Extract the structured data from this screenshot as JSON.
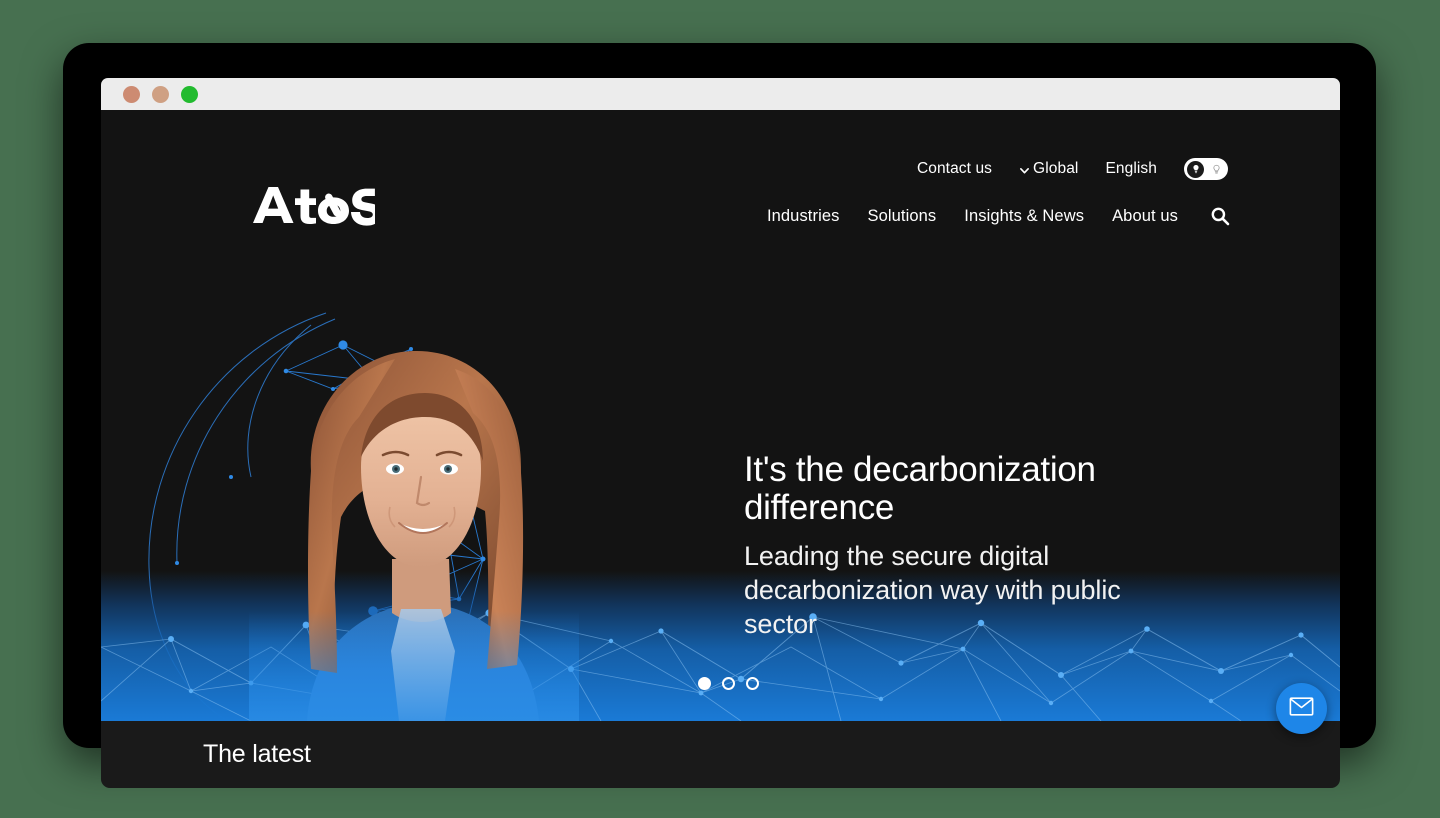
{
  "window": {
    "traffic_lights": [
      "close",
      "minimize",
      "maximize"
    ]
  },
  "brand": {
    "logo_text": "AtoS",
    "logo_alt": "Atos"
  },
  "utility_nav": {
    "items": [
      {
        "label": "Contact us",
        "icon": null,
        "name": "contact-us"
      },
      {
        "label": "Global",
        "icon": "chevron-down-icon",
        "name": "region-selector"
      },
      {
        "label": "English",
        "icon": null,
        "name": "language-selector"
      }
    ],
    "theme_toggle": {
      "name": "theme-toggle",
      "state": "dark",
      "on_icon": "lightbulb-filled-icon",
      "off_icon": "lightbulb-outline-icon"
    }
  },
  "main_nav": {
    "items": [
      {
        "label": "Industries",
        "name": "industries"
      },
      {
        "label": "Solutions",
        "name": "solutions"
      },
      {
        "label": "Insights & News",
        "name": "insights-and-news"
      },
      {
        "label": "About us",
        "name": "about-us"
      }
    ],
    "search": {
      "icon": "search-icon",
      "label": "Search"
    }
  },
  "hero": {
    "title": "It's the decarbonization difference",
    "subtitle": "Leading the secure digital decarbonization way with public sector",
    "image_alt": "Smiling woman with long auburn hair in front of a blue digital network globe",
    "carousel": {
      "total_slides": 3,
      "active_slide": 1,
      "slides": [
        "slide-1",
        "slide-2",
        "slide-3"
      ]
    }
  },
  "latest_section": {
    "title": "The latest"
  },
  "contact_fab": {
    "icon": "envelope-icon",
    "label": "Contact"
  },
  "colors": {
    "page_background": "#477050",
    "hero_background": "#131313",
    "accent_blue": "#1e86e8",
    "mesh_blue": "#1f7fe0",
    "titlebar": "#ececec",
    "latest_bar": "#1a1a1a",
    "text_primary": "#ffffff"
  }
}
